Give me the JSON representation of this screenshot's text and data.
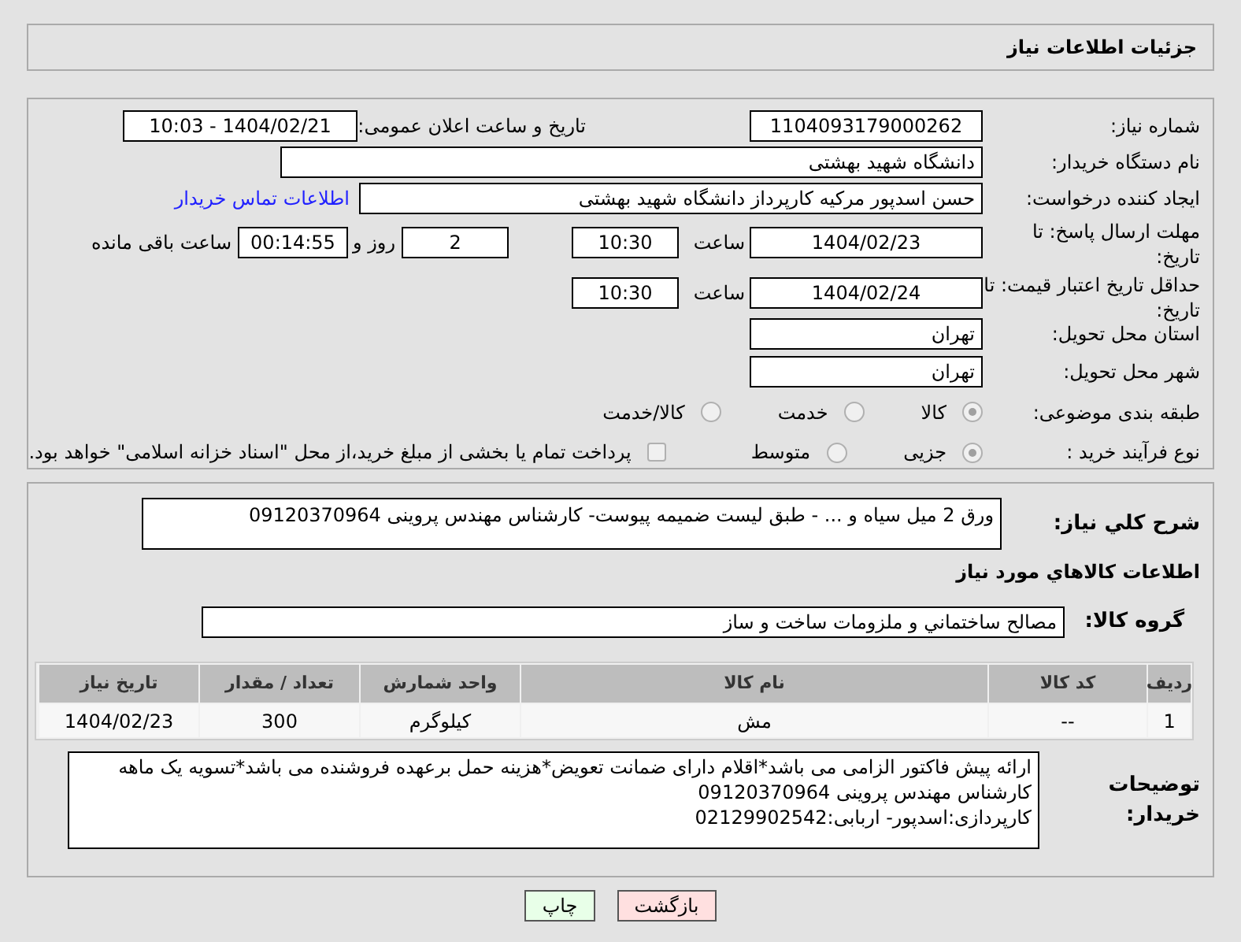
{
  "header": {
    "title": "جزئیات اطلاعات نیاز"
  },
  "details": {
    "need_number": {
      "label": "شماره نیاز:",
      "value": "1104093179000262"
    },
    "announce": {
      "label": "تاریخ و ساعت اعلان عمومی:",
      "value": "1404/02/21 - 10:03"
    },
    "buyer_org": {
      "label": "نام دستگاه خریدار:",
      "value": "دانشگاه شهید بهشتی"
    },
    "requester": {
      "label": "ایجاد کننده درخواست:",
      "value": "حسن اسدپور مرکیه کارپرداز دانشگاه شهید بهشتی",
      "link": "اطلاعات تماس خریدار"
    },
    "deadline": {
      "label": "مهلت ارسال پاسخ: تا تاریخ:",
      "date": "1404/02/23",
      "time_label": "ساعت",
      "time": "10:30",
      "days": "2",
      "days_label": "روز و",
      "remaining": "00:14:55",
      "remaining_label": "ساعت باقی مانده"
    },
    "validity": {
      "label": "حداقل تاریخ اعتبار قیمت: تا تاریخ:",
      "date": "1404/02/24",
      "time_label": "ساعت",
      "time": "10:30"
    },
    "province": {
      "label": "استان محل تحویل:",
      "value": "تهران"
    },
    "city": {
      "label": "شهر محل تحویل:",
      "value": "تهران"
    },
    "category": {
      "label": "طبقه بندی موضوعی:",
      "options": [
        {
          "label": "کالا",
          "selected": true
        },
        {
          "label": "خدمت",
          "selected": false
        },
        {
          "label": "کالا/خدمت",
          "selected": false
        }
      ]
    },
    "purchase_type": {
      "label": "نوع فرآیند خرید :",
      "options": [
        {
          "label": "جزیی",
          "selected": true
        },
        {
          "label": "متوسط",
          "selected": false
        }
      ],
      "treasury": {
        "label": "پرداخت تمام یا بخشی از مبلغ خرید،از محل \"اسناد خزانه اسلامی\" خواهد بود.",
        "checked": false
      }
    }
  },
  "goods": {
    "description": {
      "label": "شرح کلي نياز:",
      "value": "ورق 2 میل سیاه و ... - طبق لیست ضمیمه پیوست- کارشناس مهندس پروینی 09120370964"
    },
    "section_title": "اطلاعات کالاهاي مورد نياز",
    "group": {
      "label": "گروه کالا:",
      "value": "مصالح ساختماني و ملزومات ساخت و ساز"
    },
    "table": {
      "columns": [
        "ردیف",
        "کد کالا",
        "نام کالا",
        "واحد شمارش",
        "تعداد / مقدار",
        "تاریخ نیاز"
      ],
      "rows": [
        [
          "1",
          "--",
          "مش",
          "کیلوگرم",
          "300",
          "1404/02/23"
        ]
      ]
    },
    "notes": {
      "label": "توضیحات خریدار:",
      "lines": [
        "ارائه پیش فاکتور الزامی می باشد*اقلام دارای ضمانت تعویض*هزینه حمل برعهده فروشنده می باشد*تسویه یک ماهه",
        "کارشناس مهندس پروینی 09120370964",
        "کارپردازی:اسدپور- اربابی:02129902542"
      ]
    }
  },
  "buttons": [
    {
      "kind": "back",
      "label": "بازگشت"
    },
    {
      "kind": "print",
      "label": "چاپ"
    }
  ]
}
